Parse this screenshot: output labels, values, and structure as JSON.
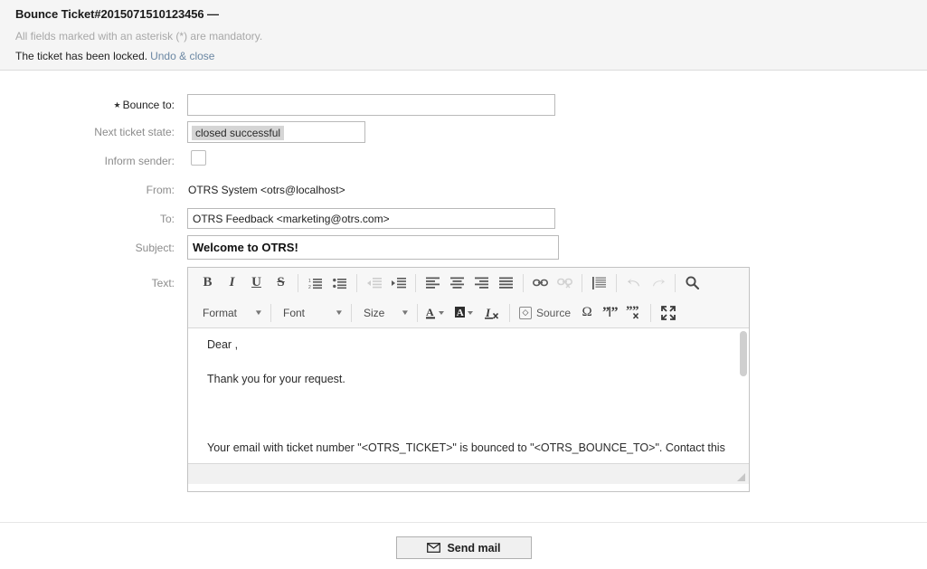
{
  "header": {
    "title": "Bounce Ticket#2015071510123456 —",
    "mandatory_note": "All fields marked with an asterisk (*) are mandatory.",
    "locked_text": "The ticket has been locked.",
    "undo_close_link": "Undo & close",
    "link_color": "#6b87a3",
    "background_color": "#f5f5f5"
  },
  "form": {
    "bounce_to": {
      "label": "Bounce to:",
      "required_marker": "★",
      "value": "",
      "placeholder": ""
    },
    "next_ticket_state": {
      "label": "Next ticket state:",
      "selected_option": "closed successful",
      "options": [
        "closed successful"
      ]
    },
    "inform_sender": {
      "label": "Inform sender:",
      "checked": false
    },
    "from": {
      "label": "From:",
      "value": "OTRS System <otrs@localhost>"
    },
    "to": {
      "label": "To:",
      "value": "OTRS Feedback <marketing@otrs.com>"
    },
    "subject": {
      "label": "Subject:",
      "value": "Welcome to OTRS!"
    },
    "text": {
      "label": "Text:"
    }
  },
  "editor": {
    "toolbar_row1": [
      {
        "name": "bold-icon",
        "label": "B"
      },
      {
        "name": "italic-icon",
        "label": "I"
      },
      {
        "name": "underline-icon",
        "label": "U"
      },
      {
        "name": "strikethrough-icon",
        "label": "S"
      },
      {
        "name": "numbered-list-icon",
        "label": ""
      },
      {
        "name": "bulleted-list-icon",
        "label": ""
      },
      {
        "name": "decrease-indent-icon",
        "label": ""
      },
      {
        "name": "increase-indent-icon",
        "label": ""
      },
      {
        "name": "align-left-icon",
        "label": ""
      },
      {
        "name": "align-center-icon",
        "label": ""
      },
      {
        "name": "align-right-icon",
        "label": ""
      },
      {
        "name": "align-justify-icon",
        "label": ""
      },
      {
        "name": "link-icon",
        "label": ""
      },
      {
        "name": "unlink-icon",
        "label": ""
      },
      {
        "name": "blockquote-icon",
        "label": ""
      },
      {
        "name": "undo-icon",
        "label": ""
      },
      {
        "name": "redo-icon",
        "label": ""
      },
      {
        "name": "find-icon",
        "label": ""
      }
    ],
    "format_combo": "Format",
    "font_combo": "Font",
    "size_combo": "Size",
    "text_color_label": "A",
    "bg_color_label": "A",
    "remove_format_label": "I",
    "source_label": "Source",
    "omega_label": "Ω",
    "body": {
      "line1": "Dear ,",
      "line2": "Thank you for your request.",
      "line3": "Your email with ticket number \"<OTRS_TICKET>\" is bounced to \"<OTRS_BOUNCE_TO>\". Contact this"
    }
  },
  "footer": {
    "send_mail_label": "Send mail",
    "send_mail_icon": "envelope-icon"
  }
}
